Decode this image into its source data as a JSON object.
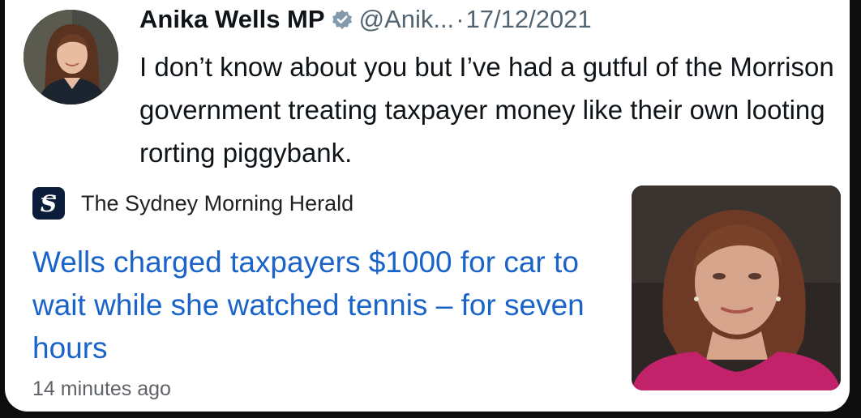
{
  "tweet": {
    "display_name": "Anika Wells MP",
    "handle": "@Anik...",
    "separator": "·",
    "date": "17/12/2021",
    "text": "I don’t know about you but I’ve had a gutful of the Morrison government treating taxpayer money like their own looting rorting piggybank.",
    "avatar_icon": "profile-photo",
    "badge_icon": "verified-badge-icon",
    "badge_color": "#829aab"
  },
  "article": {
    "source_name": "The Sydney Morning Herald",
    "source_logo_icon": "smh-logo-icon",
    "headline": "Wells charged taxpayers $1000 for car to wait while she watched tennis – for seven hours",
    "timestamp": "14 minutes ago",
    "thumbnail_icon": "article-photo",
    "headline_color": "#1a63c8"
  }
}
